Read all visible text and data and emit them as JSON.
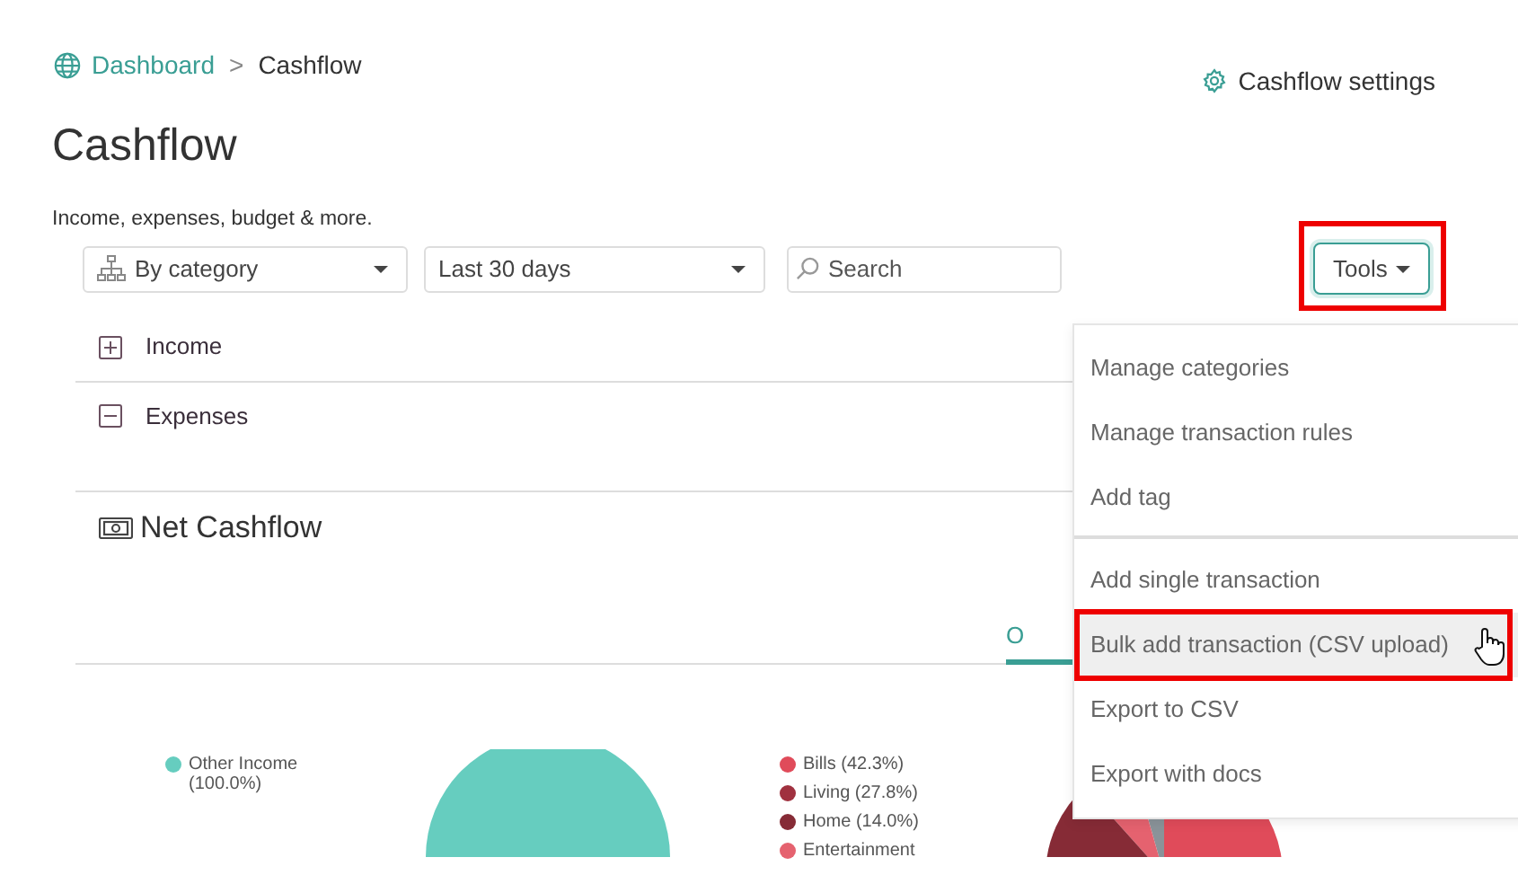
{
  "breadcrumb": {
    "link": "Dashboard",
    "separator": ">",
    "current": "Cashflow"
  },
  "settings_link": "Cashflow settings",
  "title": "Cashflow",
  "subtitle": "Income, expenses, budget & more.",
  "filters": [
    {
      "kind": "dropdown",
      "value": "By category",
      "icon": true
    },
    {
      "kind": "dropdown",
      "value": "Last 30 days",
      "icon": false
    },
    {
      "kind": "search",
      "placeholder": "Search"
    }
  ],
  "tools_button": {
    "label": "Tools",
    "highlighted": true
  },
  "sections": [
    {
      "label": "Income",
      "expanded": false
    },
    {
      "label": "Expenses",
      "expanded": true
    }
  ],
  "net_cashflow": {
    "title": "Net Cashflow",
    "tabs": [
      {
        "label": "O",
        "selected": true
      }
    ]
  },
  "income_legend": [
    {
      "label": "Other Income (100.0%)",
      "color": "#66cdbf"
    }
  ],
  "expense_legend": [
    {
      "label": "Bills (42.3%)",
      "color": "#e04b5a"
    },
    {
      "label": "Living (27.8%)",
      "color": "#a0313f"
    },
    {
      "label": "Home (14.0%)",
      "color": "#862b36"
    },
    {
      "label": "Entertainment",
      "color": "#e5626f"
    }
  ],
  "tools_menu": [
    {
      "label": "Manage categories",
      "highlighted": false,
      "divider_after": false
    },
    {
      "label": "Manage transaction rules",
      "highlighted": false,
      "divider_after": false
    },
    {
      "label": "Add tag",
      "highlighted": false,
      "divider_after": true
    },
    {
      "label": "Add single transaction",
      "highlighted": false,
      "divider_after": false
    },
    {
      "label": "Bulk add transaction (CSV upload)",
      "highlighted": true,
      "divider_after": false
    },
    {
      "label": "Export to CSV",
      "highlighted": false,
      "divider_after": false
    },
    {
      "label": "Export with docs",
      "highlighted": false,
      "divider_after": false
    }
  ]
}
